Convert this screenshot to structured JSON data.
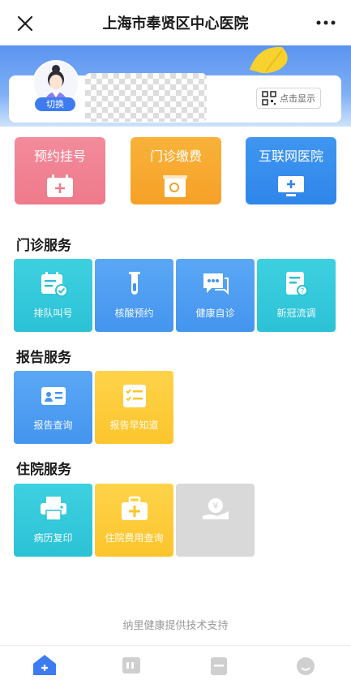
{
  "header": {
    "title": "上海市奉贤区中心医院"
  },
  "profile": {
    "switch_label": "切换",
    "show_label": "点击显示"
  },
  "quick": [
    {
      "label": "预约挂号",
      "color": "#ee7a8b"
    },
    {
      "label": "门诊缴费",
      "color": "#f6a127"
    },
    {
      "label": "互联网医院",
      "color": "#2f86ea"
    }
  ],
  "sections": {
    "outpatient": {
      "title": "门诊服务",
      "items": [
        {
          "label": "排队叫号",
          "icon": "queue-calendar-icon"
        },
        {
          "label": "核酸预约",
          "icon": "test-tube-icon"
        },
        {
          "label": "健康自诊",
          "icon": "chat-icon"
        },
        {
          "label": "新冠流调",
          "icon": "survey-doc-icon"
        }
      ]
    },
    "report": {
      "title": "报告服务",
      "items": [
        {
          "label": "报告查询",
          "icon": "report-card-icon"
        },
        {
          "label": "报告早知道",
          "icon": "checklist-icon"
        }
      ]
    },
    "inpatient": {
      "title": "住院服务",
      "items": [
        {
          "label": "病历复印",
          "icon": "printer-icon"
        },
        {
          "label": "住院费用查询",
          "icon": "medical-kit-icon"
        },
        {
          "label": "",
          "icon": "yuan-hand-icon"
        }
      ]
    }
  },
  "footer": {
    "text": "纳里健康提供技术支持"
  },
  "colors": {
    "accent": "#3d7cf0",
    "teal": "#2cc2d6",
    "blue": "#4495ef",
    "yellow": "#fbc52c"
  }
}
